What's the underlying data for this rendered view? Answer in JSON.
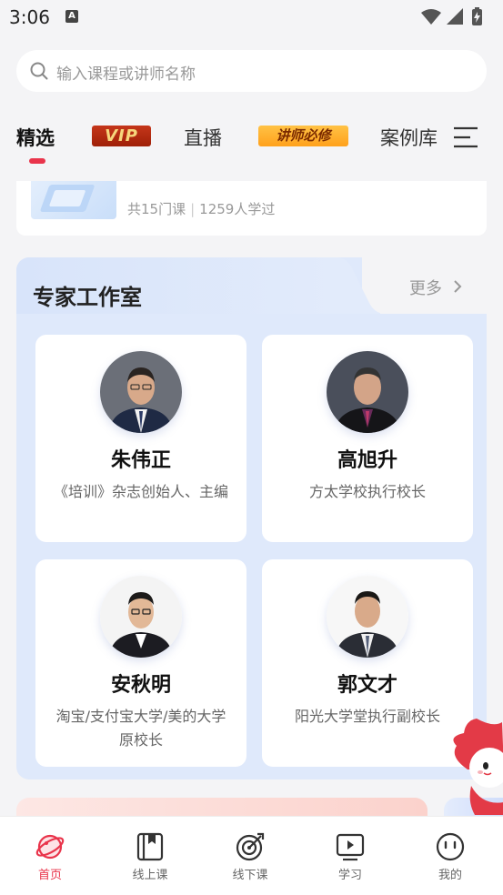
{
  "status_bar": {
    "time": "3:06",
    "notification_icon": "A"
  },
  "search": {
    "placeholder": "输入课程或讲师名称"
  },
  "tabs": [
    {
      "label": "精选",
      "active": true
    },
    {
      "label": "VIP",
      "badge": true
    },
    {
      "label": "直播"
    },
    {
      "label": "讲师必修",
      "badge": true
    },
    {
      "label": "案例库"
    }
  ],
  "course_card": {
    "count": "共15门课",
    "learners": "1259人学过"
  },
  "studio": {
    "title": "专家工作室",
    "more": "更多",
    "experts": [
      {
        "name": "朱伟正",
        "desc": "《培训》杂志创始人、主编"
      },
      {
        "name": "高旭升",
        "desc": "方太学校执行校长"
      },
      {
        "name": "安秋明",
        "desc": "淘宝/支付宝大学/美的大学原校长"
      },
      {
        "name": "郭文才",
        "desc": "阳光大学堂执行副校长"
      }
    ]
  },
  "bottom_nav": [
    {
      "label": "首页",
      "icon": "planet-icon",
      "active": true
    },
    {
      "label": "线上课",
      "icon": "bookmark-book-icon"
    },
    {
      "label": "线下课",
      "icon": "target-icon"
    },
    {
      "label": "学习",
      "icon": "play-screen-icon"
    },
    {
      "label": "我的",
      "icon": "face-icon"
    }
  ],
  "colors": {
    "accent": "#e9344b",
    "studio_bg": "#dfe9fb",
    "vip_bg": "#b02a10",
    "must_bg": "#ffae2a"
  }
}
